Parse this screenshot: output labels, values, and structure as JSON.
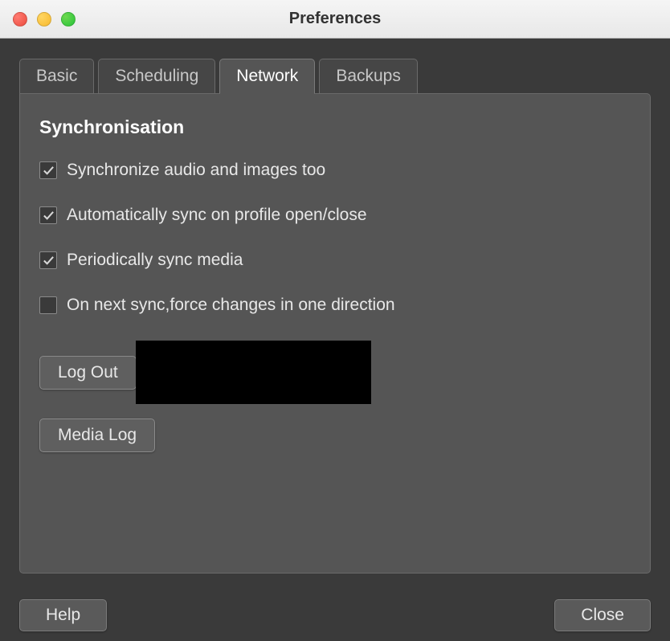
{
  "window": {
    "title": "Preferences"
  },
  "tabs": [
    {
      "label": "Basic",
      "active": false
    },
    {
      "label": "Scheduling",
      "active": false
    },
    {
      "label": "Network",
      "active": true
    },
    {
      "label": "Backups",
      "active": false
    }
  ],
  "network": {
    "section_heading": "Synchronisation",
    "options": [
      {
        "label": "Synchronize audio and images too",
        "checked": true
      },
      {
        "label": "Automatically sync on profile open/close",
        "checked": true
      },
      {
        "label": "Periodically sync media",
        "checked": true
      },
      {
        "label": "On next sync,force changes in one direction",
        "checked": false
      }
    ],
    "logout_button": "Log Out",
    "medialog_button": "Media Log"
  },
  "footer": {
    "help_button": "Help",
    "close_button": "Close"
  }
}
